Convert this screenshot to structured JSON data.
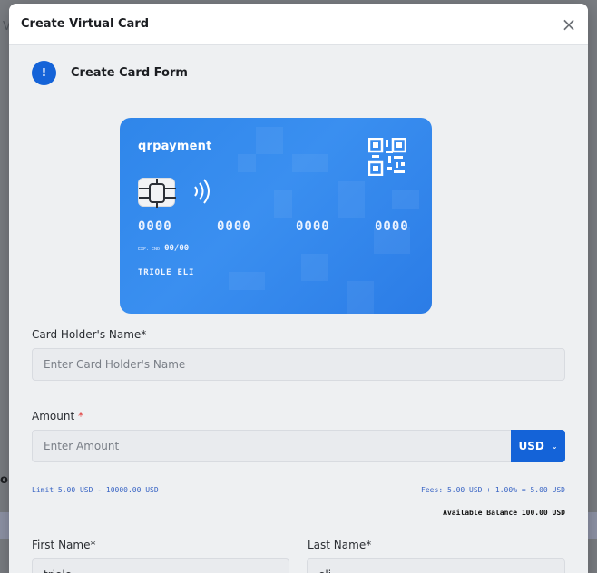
{
  "backdrop": {
    "fragment_top": "V",
    "fragment_left": "or"
  },
  "modal": {
    "title": "Create Virtual Card",
    "close_glyph": "×"
  },
  "form_header": {
    "icon_glyph": "!",
    "title": "Create Card Form"
  },
  "card": {
    "brand": "qrpayment",
    "number_groups": [
      "0000",
      "0000",
      "0000",
      "0000"
    ],
    "exp_label": "EXP. END:",
    "exp_value": "00/00",
    "holder_name": "TRIOLE ELI",
    "accent": "#2f86ea"
  },
  "fields": {
    "holder_label": "Card Holder's Name*",
    "holder_placeholder": "Enter Card Holder's Name",
    "amount_label": "Amount",
    "amount_required": "*",
    "amount_placeholder": "Enter Amount",
    "currency": "USD",
    "limit_text": "Limit 5.00 USD - 10000.00 USD",
    "fees_text": "Fees: 5.00 USD + 1.00% = 5.00 USD",
    "balance_text": "Available Balance 100.00 USD",
    "first_name_label": "First Name*",
    "first_name_value": "triole",
    "last_name_label": "Last Name*",
    "last_name_value": "eli"
  },
  "colors": {
    "primary": "#1463d8",
    "modal_bg": "#eef0f2"
  }
}
